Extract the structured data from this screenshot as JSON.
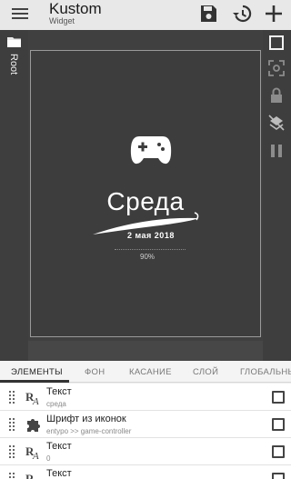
{
  "header": {
    "title": "Kustom",
    "subtitle": "Widget",
    "icons": [
      "menu-icon",
      "save-icon",
      "history-icon",
      "add-icon"
    ]
  },
  "left_rail": {
    "icon": "folder-icon",
    "root_label": "Root"
  },
  "right_rail": {
    "icons": [
      "square-icon",
      "focus-icon",
      "lock-icon",
      "layers-off-icon",
      "pause-icon"
    ]
  },
  "widget_preview": {
    "icon": "game-controller-icon",
    "day": "Среда",
    "date": "2 мая 2018",
    "percent": "90%"
  },
  "tabs": [
    {
      "label": "ЭЛЕМЕНТЫ",
      "active": true
    },
    {
      "label": "ФОН",
      "active": false
    },
    {
      "label": "КАСАНИЕ",
      "active": false
    },
    {
      "label": "СЛОЙ",
      "active": false
    },
    {
      "label": "ГЛОБАЛЬНЫ",
      "active": false
    }
  ],
  "items": [
    {
      "icon": "text-icon",
      "title": "Текст",
      "subtitle": "среда"
    },
    {
      "icon": "puzzle-icon",
      "title": "Шрифт из иконок",
      "subtitle": "entypo >> game-controller"
    },
    {
      "icon": "text-icon",
      "title": "Текст",
      "subtitle": "0"
    },
    {
      "icon": "text-icon",
      "title": "Текст",
      "subtitle": ""
    }
  ],
  "colors": {
    "editor_bg": "#4a4a4a",
    "rail_bg": "#3e3e3e",
    "toolbar_bg": "#e8e8e8",
    "active_tab": "#333333"
  }
}
